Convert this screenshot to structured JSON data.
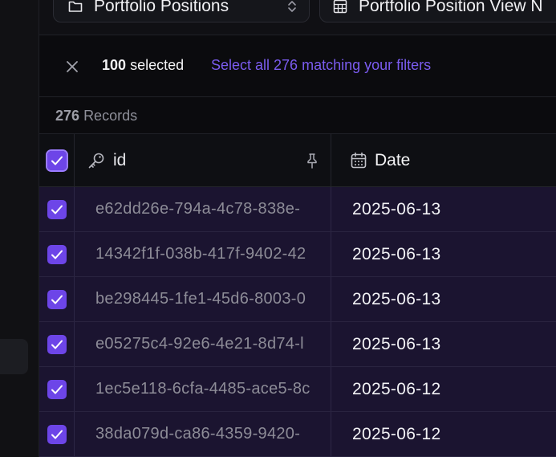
{
  "colors": {
    "accent": "#6d45e8",
    "link": "#7b5cf0",
    "selected_row_bg": "#1b1430"
  },
  "toolbar": {
    "object_select": {
      "label": "Portfolio Positions",
      "icon": "folder-icon"
    },
    "view_select": {
      "label": "Portfolio Position View N",
      "icon": "table-icon"
    }
  },
  "selection": {
    "count": "100",
    "count_suffix": "selected",
    "select_all_link": "Select all 276 matching your filters"
  },
  "records": {
    "count": "276",
    "label": "Records"
  },
  "table": {
    "columns": [
      {
        "label": "id",
        "icon": "key-icon"
      },
      {
        "label": "Date",
        "icon": "calendar-icon"
      }
    ],
    "rows": [
      {
        "id": "e62dd26e-794a-4c78-838e-",
        "date": "2025-06-13",
        "checked": true
      },
      {
        "id": "14342f1f-038b-417f-9402-42",
        "date": "2025-06-13",
        "checked": true
      },
      {
        "id": "be298445-1fe1-45d6-8003-0",
        "date": "2025-06-13",
        "checked": true
      },
      {
        "id": "e05275c4-92e6-4e21-8d74-l",
        "date": "2025-06-13",
        "checked": true
      },
      {
        "id": "1ec5e118-6cfa-4485-ace5-8c",
        "date": "2025-06-12",
        "checked": true
      },
      {
        "id": "38da079d-ca86-4359-9420-",
        "date": "2025-06-12",
        "checked": true
      }
    ]
  }
}
